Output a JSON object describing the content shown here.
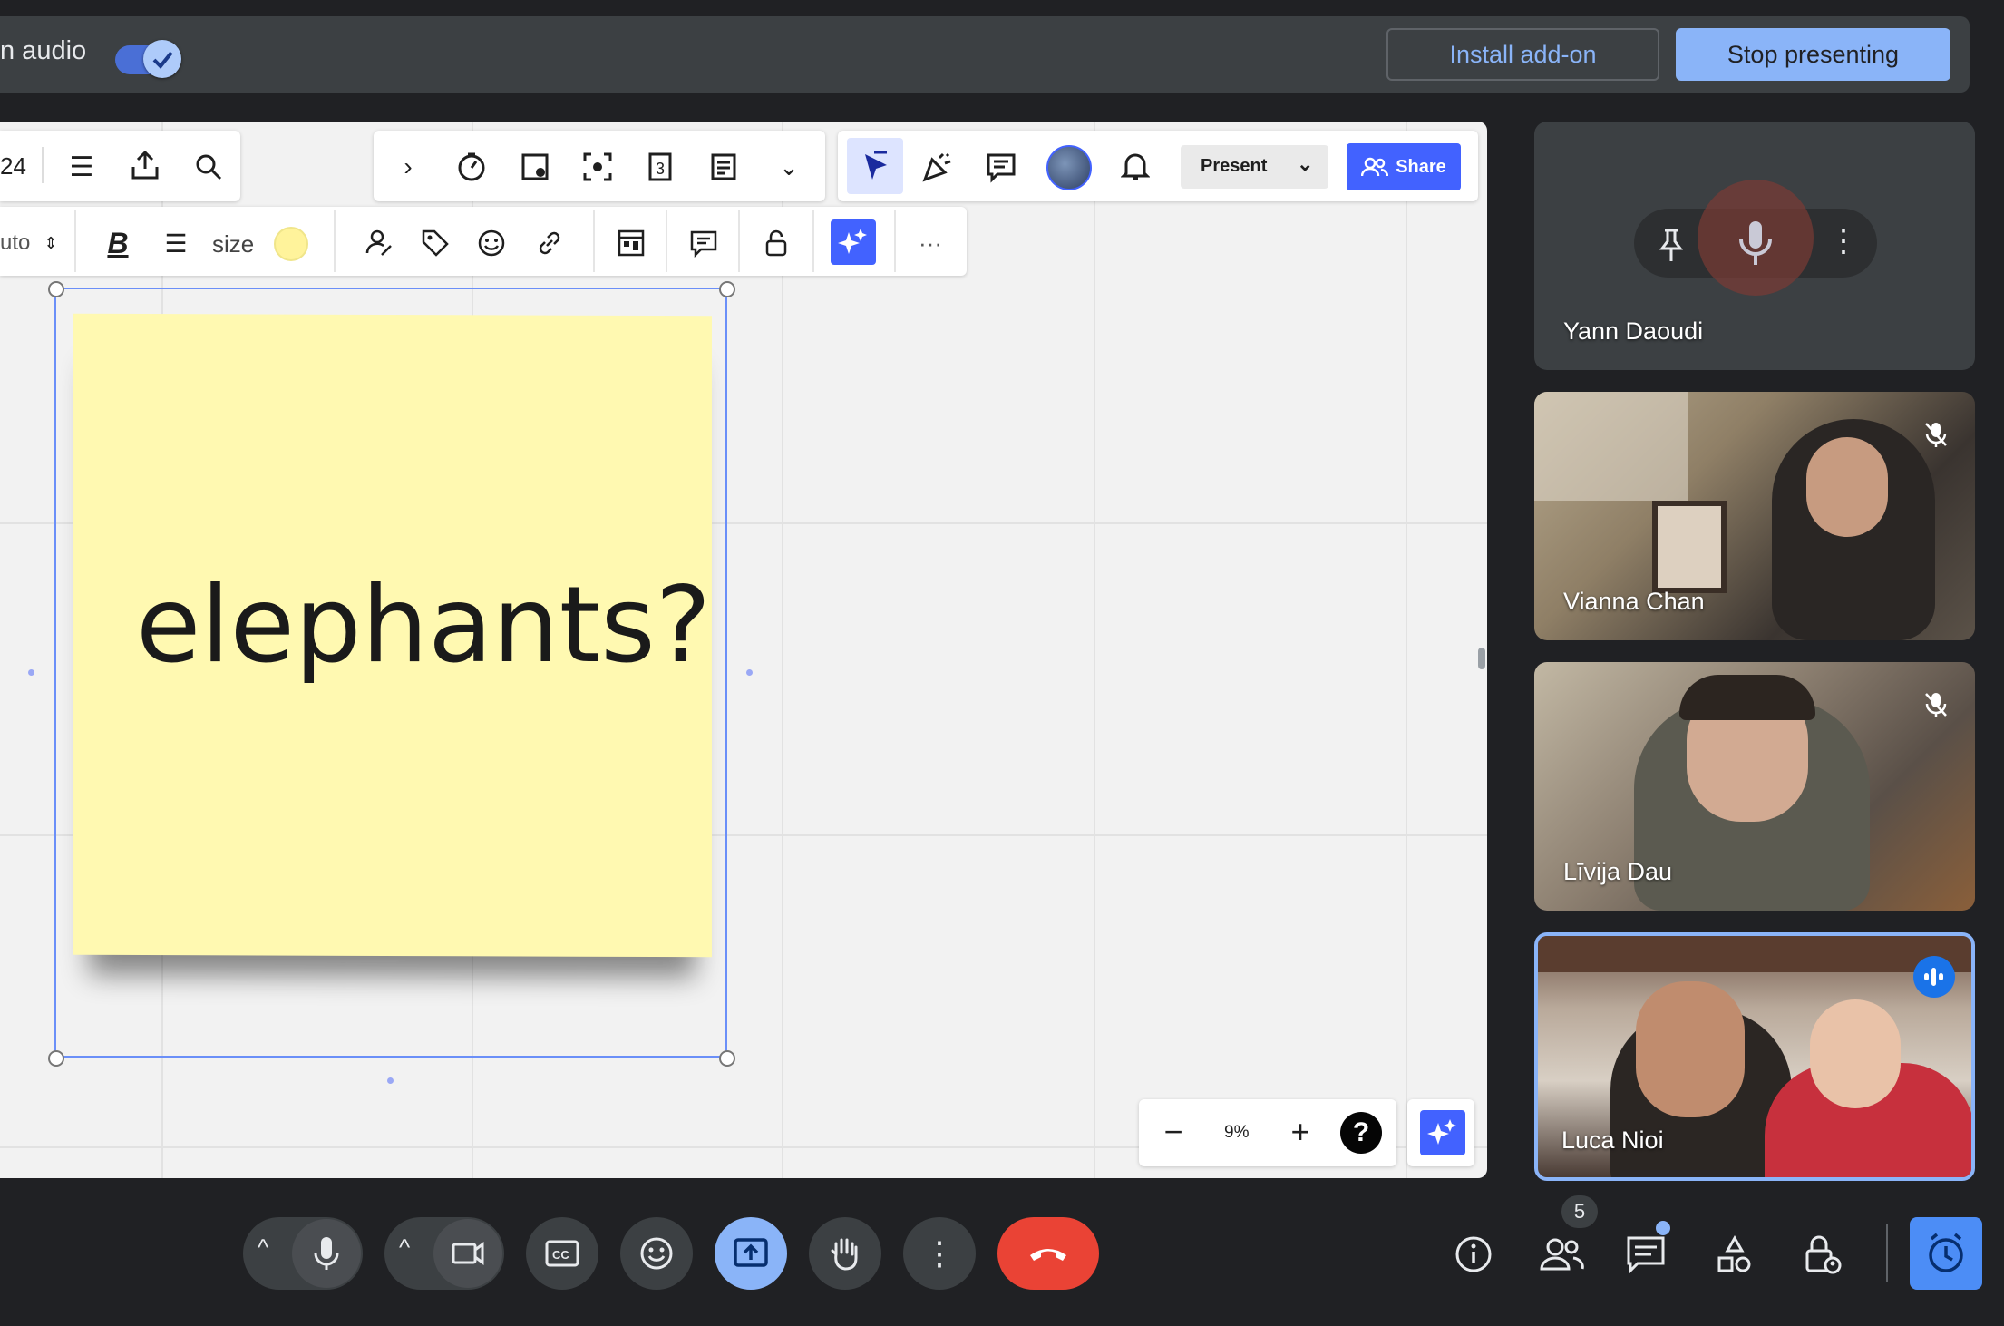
{
  "present_bar": {
    "audio_label": "n audio",
    "install_label": "Install add-on",
    "stop_label": "Stop presenting"
  },
  "board": {
    "left_toolbar_num": "24",
    "present_label": "Present",
    "share_label": "Share",
    "format_bar": {
      "font_partial": "uto",
      "size_label": "size"
    },
    "sticky_note_text": "elephants?",
    "zoom_level": "9%",
    "help_label": "?"
  },
  "participants": [
    {
      "name": "Yann Daoudi",
      "muted": false
    },
    {
      "name": "Vianna Chan",
      "muted": true
    },
    {
      "name": "Līvija Dau",
      "muted": true
    },
    {
      "name": "Luca Nioi",
      "speaking": true
    }
  ],
  "bottom_right": {
    "people_count": "5"
  },
  "colors": {
    "accent": "#8ab4f8",
    "miro_blue": "#4262ff",
    "hangup": "#ea4335",
    "sticky": "#fff9b1"
  }
}
